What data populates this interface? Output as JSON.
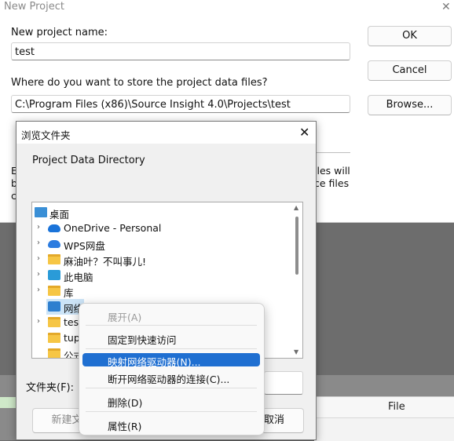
{
  "new_project_dialog": {
    "title": "New Project",
    "close_glyph": "✕",
    "name_label": "New project name:",
    "name_value": "test",
    "store_label": "Where do you want to store the project data files?",
    "store_path": "C:\\Program Files (x86)\\Source Insight 4.0\\Projects\\test",
    "ok_label": "OK",
    "cancel_label": "Cancel",
    "browse_label": "Browse...",
    "occluded_left_chars": [
      "E",
      "b",
      "c"
    ],
    "occluded_right_line1": "iles will",
    "occluded_right_line2": "ce files"
  },
  "browse_folder_dialog": {
    "title": "浏览文件夹",
    "close_glyph": "✕",
    "description": "Project Data Directory",
    "tree": [
      {
        "label": "桌面",
        "icon": "desktop-icon",
        "chevron": ""
      },
      {
        "label": "OneDrive - Personal",
        "icon": "cloud-icon",
        "chevron": "›"
      },
      {
        "label": "WPS网盘",
        "icon": "cloud-icon",
        "chevron": "›"
      },
      {
        "label": "麻油叶？不叫事儿!",
        "icon": "folder-icon",
        "chevron": "›"
      },
      {
        "label": "此电脑",
        "icon": "computer-icon",
        "chevron": "›"
      },
      {
        "label": "库",
        "icon": "folder-icon",
        "chevron": "›"
      },
      {
        "label": "网络",
        "icon": "network-icon",
        "chevron": ""
      },
      {
        "label": "test",
        "icon": "folder-icon",
        "chevron": "›"
      },
      {
        "label": "tupi",
        "icon": "folder-icon",
        "chevron": ""
      },
      {
        "label": "公式",
        "icon": "folder-icon",
        "chevron": ""
      }
    ],
    "folder_label": "文件夹(F):",
    "folder_value": "",
    "new_folder_label": "新建文",
    "cancel_label": "取消"
  },
  "context_menu": {
    "items": [
      {
        "label": "展开(A)",
        "state": "disabled"
      },
      {
        "label": "固定到快速访问",
        "state": "normal"
      },
      {
        "label": "映射网络驱动器(N)...",
        "state": "highlight"
      },
      {
        "label": "断开网络驱动器的连接(C)...",
        "state": "normal"
      },
      {
        "label": "删除(D)",
        "state": "normal"
      },
      {
        "label": "属性(R)",
        "state": "normal"
      }
    ]
  },
  "background_app": {
    "table_header": "File"
  }
}
